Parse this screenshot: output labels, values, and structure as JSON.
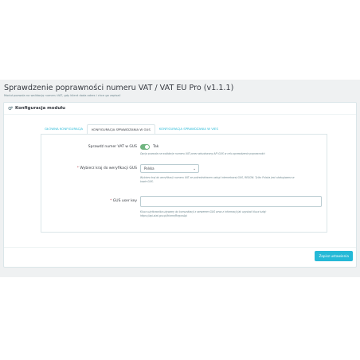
{
  "header": {
    "title": "Sprawdzenie poprawności numeru VAT / VAT EU Pro (v1.1.1)",
    "subtitle": "Moduł pozwala na walidację numeru VAT, gdy klient doda adres i chce go zapisać"
  },
  "panel": {
    "heading": "Konfiguracja modułu",
    "heading_icon": "gears-icon"
  },
  "tabs": [
    {
      "label": "GŁÓWNA KONFIGURACJA",
      "active": false
    },
    {
      "label": "KONFIGURACJA SPRAWDZANIA W GUS",
      "active": true
    },
    {
      "label": "KONFIGURACJA SPRAWDZANIA W VIES",
      "active": false
    }
  ],
  "form": {
    "check_vat": {
      "label": "Sprawdź numer VAT w GUS",
      "toggle_value": "Tak",
      "help": "Opcja pozwala na walidacje numeru VAT przez wbudowany API GUS w celu sprawdzenia poprawności"
    },
    "country": {
      "required_mark": "*",
      "label": "Wybierz kraj do weryfikacji GUS",
      "selected": "Polska",
      "help": "Wybierz kraj do weryfikacji numeru VAT ze pośrednictwem usługi internetowej GUS, REGON. Tylko Polska jest obsługiwana w bazie GUS."
    },
    "gus_key": {
      "required_mark": "*",
      "label": "GUS user key",
      "value": "",
      "help": "Klucz użytkownika używany do komunikacji z serwerem GUS wraz z informacji jak uzyskać klucz tutaj: https://api.stat.gov.pl/Home/RegonApi"
    }
  },
  "actions": {
    "save_label": "Zapisz ustawienia"
  },
  "colors": {
    "accent": "#25b9d7",
    "toggle_on": "#70b580",
    "required": "#c05c67",
    "background": "#eff1f2"
  }
}
